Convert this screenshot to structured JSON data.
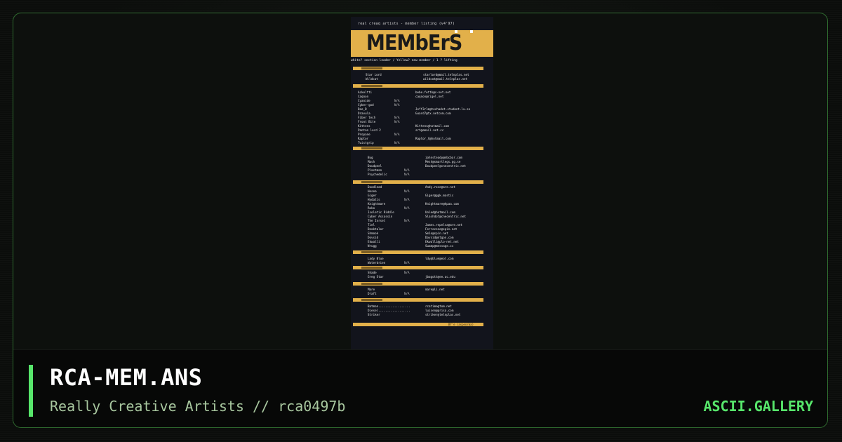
{
  "art": {
    "header_line": "real creaq artists - member listing (v4'97)",
    "banner_text": "MEMbErS",
    "subline": "white? section leader / Yellow? new member / 1    ? lifting",
    "sections": [
      {
        "rows": [
          {
            "name": "Star Lord",
            "status": "",
            "email": "starlord@mail.telnplas.net"
          },
          {
            "name": "Wildcat",
            "status": "",
            "email": "wildcat@mail.telnplas.net"
          }
        ]
      },
      {
        "rows": [
          {
            "name": "Ackeltti",
            "status": "",
            "email": "bebe.fettk@s-net.net"
          },
          {
            "name": "Caqnon",
            "status": "",
            "email": "caqnon@rigel.net"
          },
          {
            "name": "Cyanide",
            "status": "N/A",
            "email": ""
          },
          {
            "name": "Cyber-god",
            "status": "N/A",
            "email": ""
          },
          {
            "name": "Dee_D",
            "status": "",
            "email": "Jeff3rlm@techadet.student.lu.se"
          },
          {
            "name": "Dravula",
            "status": "",
            "email": "Guard7@tx.netcom.com"
          },
          {
            "name": "Fiber tech",
            "status": "N/A",
            "email": ""
          },
          {
            "name": "Front Bite",
            "status": "N/A",
            "email": ""
          },
          {
            "name": "Kittens",
            "status": "",
            "email": "Kittens@hotmail.com"
          },
          {
            "name": "Pantan lord 2",
            "status": "",
            "email": "srt@email.net.cc"
          },
          {
            "name": "Propane",
            "status": "N/A",
            "email": ""
          },
          {
            "name": "Raptor",
            "status": "",
            "email": "Raptor_X@hotmail.com"
          },
          {
            "name": "Twistgrip",
            "status": "N/A",
            "email": ""
          }
        ]
      },
      {
        "rows": [
          {
            "name": "Bug",
            "status": "",
            "email": "johnsteady@nbcbar.com"
          },
          {
            "name": "Mash",
            "status": "",
            "email": "Mesh@smartlegs.gg.se"
          },
          {
            "name": "Doudpeel",
            "status": "",
            "email": "Doudpeel@cnecentric.net"
          },
          {
            "name": "Plastman",
            "status": "N/A",
            "email": ""
          },
          {
            "name": "Psychedelic",
            "status": "N/A",
            "email": ""
          }
        ]
      },
      {
        "rows": [
          {
            "name": "Doodlead",
            "status": "",
            "email": "Andy.rose@are.net"
          },
          {
            "name": "Hosea",
            "status": "N/A",
            "email": ""
          },
          {
            "name": "Giger",
            "status": "",
            "email": "Giger@ggk.mastic"
          },
          {
            "name": "Hydatis",
            "status": "N/A",
            "email": ""
          },
          {
            "name": "Knightmare",
            "status": "",
            "email": "Knightmare@kpaa.com"
          },
          {
            "name": "Roko",
            "status": "N/A",
            "email": ""
          },
          {
            "name": "Isoletic Riddle",
            "status": "",
            "email": "Unled@hotmail.com"
          },
          {
            "name": "Cyber Assassin",
            "status": "",
            "email": "Slashdot@cnecentric.net"
          },
          {
            "name": "The Inrset",
            "status": "N/A",
            "email": ""
          },
          {
            "name": "Tiel",
            "status": "",
            "email": "James.repelsa@are.net"
          },
          {
            "name": "Deaktalor",
            "status": "",
            "email": "Ferrocene@spin.net"
          },
          {
            "name": "Shmook",
            "status": "",
            "email": "Sm1o@spin.net"
          },
          {
            "name": "Dovsid",
            "status": "",
            "email": "Dovsid@ntgon.com"
          },
          {
            "name": "Ekwalli",
            "status": "",
            "email": "Ekwalli@plo-net.net"
          },
          {
            "name": "Nrugg",
            "status": "",
            "email": "Swamp@message.cc"
          }
        ]
      },
      {
        "rows": [
          {
            "name": "Lady Blue",
            "status": "",
            "email": "ldy@blue@eol.com"
          },
          {
            "name": "Waterbrien",
            "status": "N/A",
            "email": ""
          }
        ]
      },
      {
        "rows": [
          {
            "name": "Shade",
            "status": "N/A",
            "email": ""
          },
          {
            "name": "Greg Star",
            "status": "",
            "email": "jbagott@ee.ac.edu"
          }
        ]
      },
      {
        "rows": [
          {
            "name": "Mare",
            "status": "",
            "email": "mare@li.net"
          },
          {
            "name": "Draft",
            "status": "N/A",
            "email": ""
          }
        ]
      },
      {
        "rows": [
          {
            "name": "Batman..................",
            "status": "",
            "email": "rcatime@tom.net"
          },
          {
            "name": "Diesel..................",
            "status": "",
            "email": "luisen@prisa.com"
          },
          {
            "name": "Striker",
            "status": "",
            "email": "striker@telnplas.net"
          }
        ]
      }
    ],
    "footer_text": "BY'e  (aspen/ma)"
  },
  "card": {
    "title": "RCA-MEM.ANS",
    "subtitle": "Really Creative Artists // rca0497b",
    "brand": "ASCII.GALLERY"
  },
  "colors": {
    "accent": "#57e66b",
    "banner": "#e2b04a",
    "frame": "#2f6b2f"
  }
}
